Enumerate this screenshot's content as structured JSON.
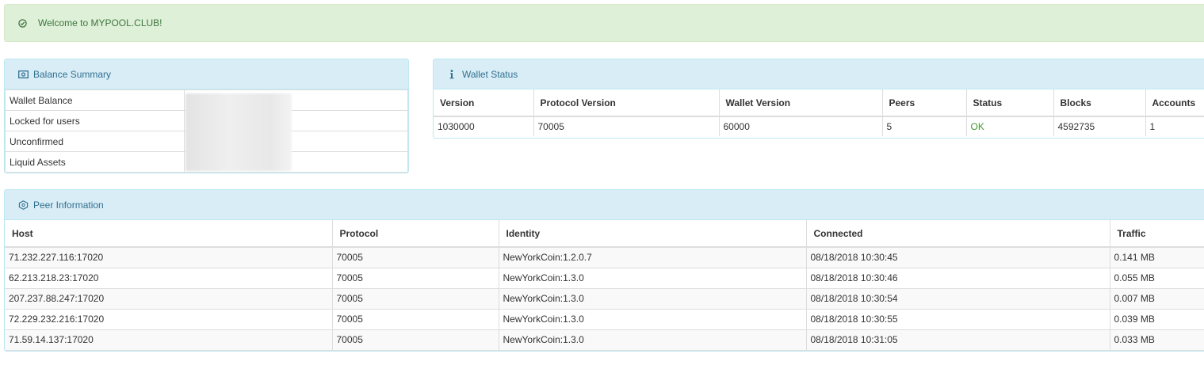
{
  "alert": {
    "message": "Welcome to MYPOOL.CLUB!",
    "icon": "check-circle-icon",
    "color": "#3c763d"
  },
  "balance": {
    "title": "Balance Summary",
    "icon": "money-icon",
    "rows": [
      {
        "label": "Wallet Balance",
        "value": ""
      },
      {
        "label": "Locked for users",
        "value": ""
      },
      {
        "label": "Unconfirmed",
        "value": ""
      },
      {
        "label": "Liquid Assets",
        "value": ""
      }
    ]
  },
  "wallet": {
    "title": "Wallet Status",
    "icon": "info-icon",
    "headers": [
      "Version",
      "Protocol Version",
      "Wallet Version",
      "Peers",
      "Status",
      "Blocks",
      "Accounts"
    ],
    "row": [
      "1030000",
      "70005",
      "60000",
      "5",
      "OK",
      "4592735",
      "1"
    ]
  },
  "peers": {
    "title": "Peer Information",
    "icon": "network-icon",
    "headers": [
      "Host",
      "Protocol",
      "Identity",
      "Connected",
      "Traffic"
    ],
    "rows": [
      [
        "71.232.227.116:17020",
        "70005",
        "NewYorkCoin:1.2.0.7",
        "08/18/2018 10:30:45",
        "0.141 MB"
      ],
      [
        "62.213.218.23:17020",
        "70005",
        "NewYorkCoin:1.3.0",
        "08/18/2018 10:30:46",
        "0.055 MB"
      ],
      [
        "207.237.88.247:17020",
        "70005",
        "NewYorkCoin:1.3.0",
        "08/18/2018 10:30:54",
        "0.007 MB"
      ],
      [
        "72.229.232.216:17020",
        "70005",
        "NewYorkCoin:1.3.0",
        "08/18/2018 10:30:55",
        "0.039 MB"
      ],
      [
        "71.59.14.137:17020",
        "70005",
        "NewYorkCoin:1.3.0",
        "08/18/2018 10:31:05",
        "0.033 MB"
      ]
    ]
  }
}
